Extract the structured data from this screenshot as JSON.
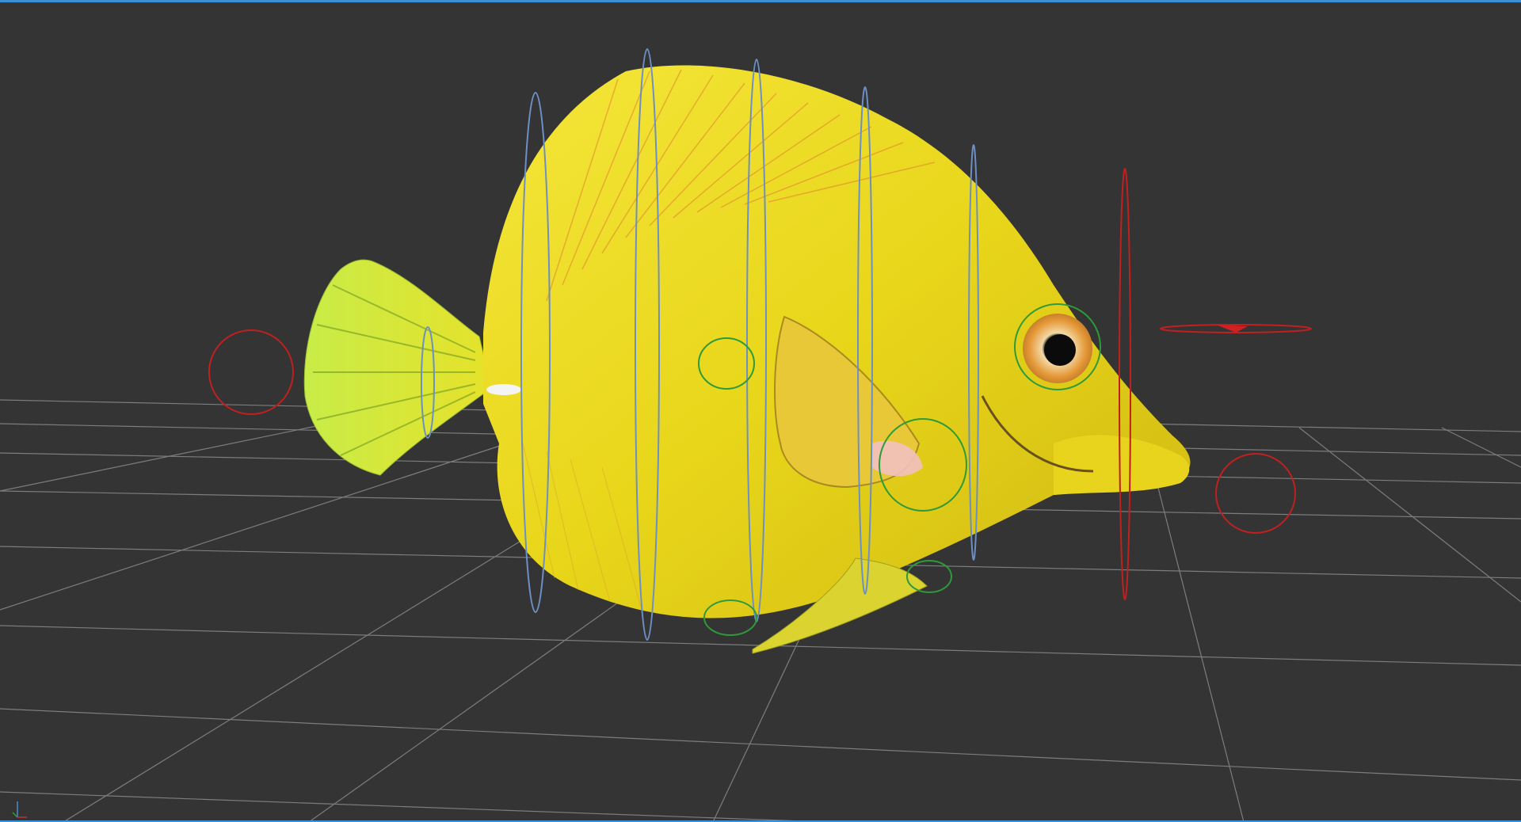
{
  "viewport": {
    "border_color": "#3d8fd6",
    "background": "#343434",
    "grid_color": "#8a8a8a"
  },
  "model": {
    "icon": "yellow-tang-fish",
    "body_color": "#f0e020",
    "fin_color": "#b6e03a",
    "stripe_color": "#e07a2a"
  },
  "rig": {
    "spine_control_color": "#6c8fc4",
    "fk_control_color": "#2e9a3a",
    "ik_control_color": "#c02020"
  },
  "axis_gizmo": {
    "icon": "axis-tripod-icon"
  }
}
